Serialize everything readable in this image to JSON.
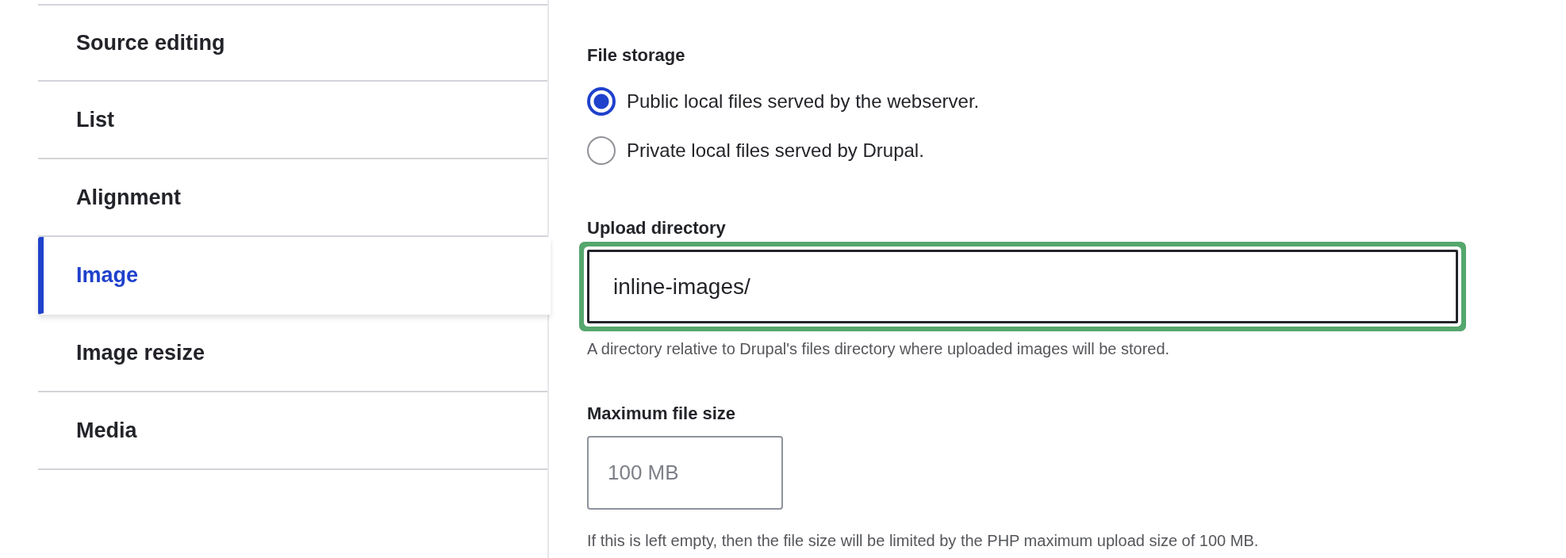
{
  "sidebar": {
    "items": [
      {
        "label": "Source editing",
        "selected": false
      },
      {
        "label": "List",
        "selected": false
      },
      {
        "label": "Alignment",
        "selected": false
      },
      {
        "label": "Image",
        "selected": true
      },
      {
        "label": "Image resize",
        "selected": false
      },
      {
        "label": "Media",
        "selected": false
      }
    ]
  },
  "file_storage": {
    "label": "File storage",
    "options": [
      {
        "label": "Public local files served by the webserver.",
        "selected": true
      },
      {
        "label": "Private local files served by Drupal.",
        "selected": false
      }
    ]
  },
  "upload_directory": {
    "label": "Upload directory",
    "value": "inline-images/",
    "focused": true,
    "description": "A directory relative to Drupal's files directory where uploaded images will be stored."
  },
  "max_file_size": {
    "label": "Maximum file size",
    "placeholder": "100 MB",
    "focused": false,
    "description": "If this is left empty, then the file size will be limited by the PHP maximum upload size of 100 MB."
  }
}
